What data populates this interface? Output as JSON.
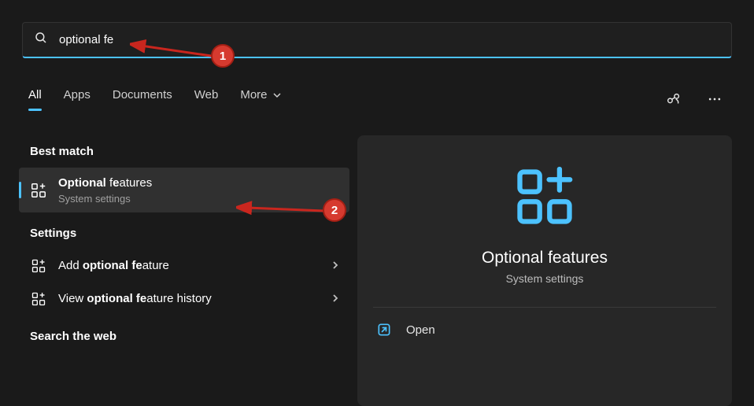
{
  "search": {
    "value": "optional fe"
  },
  "tabs": {
    "items": [
      {
        "label": "All"
      },
      {
        "label": "Apps"
      },
      {
        "label": "Documents"
      },
      {
        "label": "Web"
      },
      {
        "label": "More"
      }
    ]
  },
  "sections": {
    "best_match": "Best match",
    "settings": "Settings",
    "search_web": "Search the web"
  },
  "results": {
    "best": {
      "title_prefix_bold": "Optional ",
      "title_rest_before": "f",
      "title_rest_after": "atures",
      "title_mid_bold": "e",
      "sub": "System settings"
    },
    "settings": [
      {
        "prefix": "Add ",
        "bold_mid": "optional fe",
        "suffix": "ature"
      },
      {
        "prefix": "View ",
        "bold_mid": "optional fe",
        "suffix": "ature history"
      }
    ]
  },
  "preview": {
    "title": "Optional features",
    "sub": "System settings",
    "action_open": "Open"
  },
  "markers": {
    "one": "1",
    "two": "2"
  }
}
